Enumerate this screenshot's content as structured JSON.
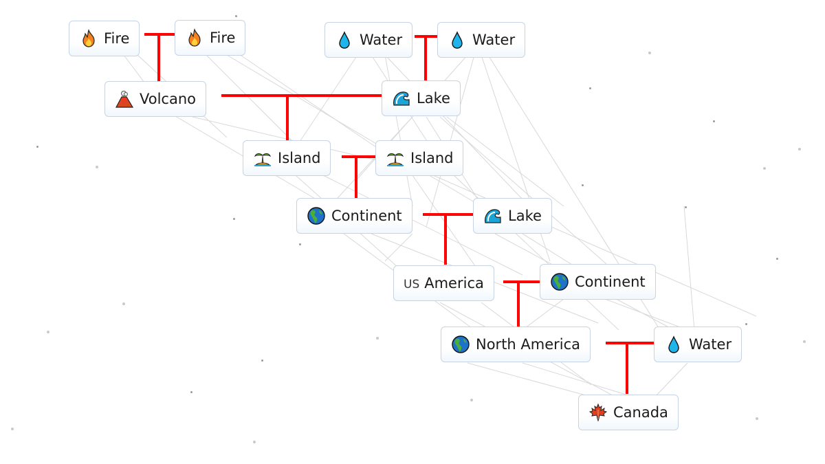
{
  "game": "Infinite Craft recipe tree",
  "connector_color": "#ff0000",
  "nodes": [
    {
      "id": "fire1",
      "label": "Fire",
      "icon": "fire-icon"
    },
    {
      "id": "fire2",
      "label": "Fire",
      "icon": "fire-icon"
    },
    {
      "id": "water1",
      "label": "Water",
      "icon": "water-drop-icon"
    },
    {
      "id": "water2",
      "label": "Water",
      "icon": "water-drop-icon"
    },
    {
      "id": "volcano",
      "label": "Volcano",
      "icon": "volcano-icon"
    },
    {
      "id": "lake1",
      "label": "Lake",
      "icon": "wave-icon"
    },
    {
      "id": "island1",
      "label": "Island",
      "icon": "desert-island-icon"
    },
    {
      "id": "island2",
      "label": "Island",
      "icon": "desert-island-icon"
    },
    {
      "id": "continent1",
      "label": "Continent",
      "icon": "globe-americas-icon"
    },
    {
      "id": "lake2",
      "label": "Lake",
      "icon": "wave-icon"
    },
    {
      "id": "america",
      "label": "America",
      "icon": "us-flag-icon",
      "icon_text": "US"
    },
    {
      "id": "continent2",
      "label": "Continent",
      "icon": "globe-americas-icon"
    },
    {
      "id": "north_america",
      "label": "North America",
      "icon": "globe-americas-icon"
    },
    {
      "id": "water3",
      "label": "Water",
      "icon": "water-drop-icon"
    },
    {
      "id": "canada",
      "label": "Canada",
      "icon": "maple-leaf-icon"
    }
  ],
  "recipes": [
    {
      "inputs": [
        "Fire",
        "Fire"
      ],
      "result": "Volcano"
    },
    {
      "inputs": [
        "Water",
        "Water"
      ],
      "result": "Lake"
    },
    {
      "inputs": [
        "Volcano",
        "Lake"
      ],
      "result": "Island"
    },
    {
      "inputs": [
        "Island",
        "Island"
      ],
      "result": "Continent"
    },
    {
      "inputs": [
        "Continent",
        "Lake"
      ],
      "result": "America"
    },
    {
      "inputs": [
        "America",
        "Continent"
      ],
      "result": "North America"
    },
    {
      "inputs": [
        "North America",
        "Water"
      ],
      "result": "Canada"
    }
  ]
}
